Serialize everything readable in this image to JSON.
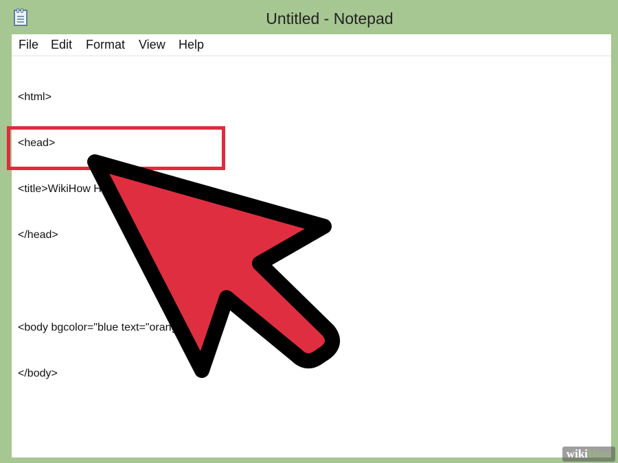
{
  "window": {
    "title": "Untitled - Notepad",
    "icon": "notepad-icon"
  },
  "menu": {
    "items": [
      {
        "label": "File"
      },
      {
        "label": "Edit"
      },
      {
        "label": "Format"
      },
      {
        "label": "View"
      },
      {
        "label": "Help"
      }
    ]
  },
  "editor": {
    "lines": [
      "<html>",
      "<head>",
      "<title>WikiHow HTML</title>",
      "</head>",
      "",
      "<body bgcolor=\"blue text=\"orange\">",
      "</body>"
    ]
  },
  "annotation": {
    "highlight_color": "#e12a3c",
    "arrow_color": "#e02e41",
    "arrow_outline": "#000000"
  },
  "watermark": {
    "wiki": "wiki",
    "how": "How"
  }
}
